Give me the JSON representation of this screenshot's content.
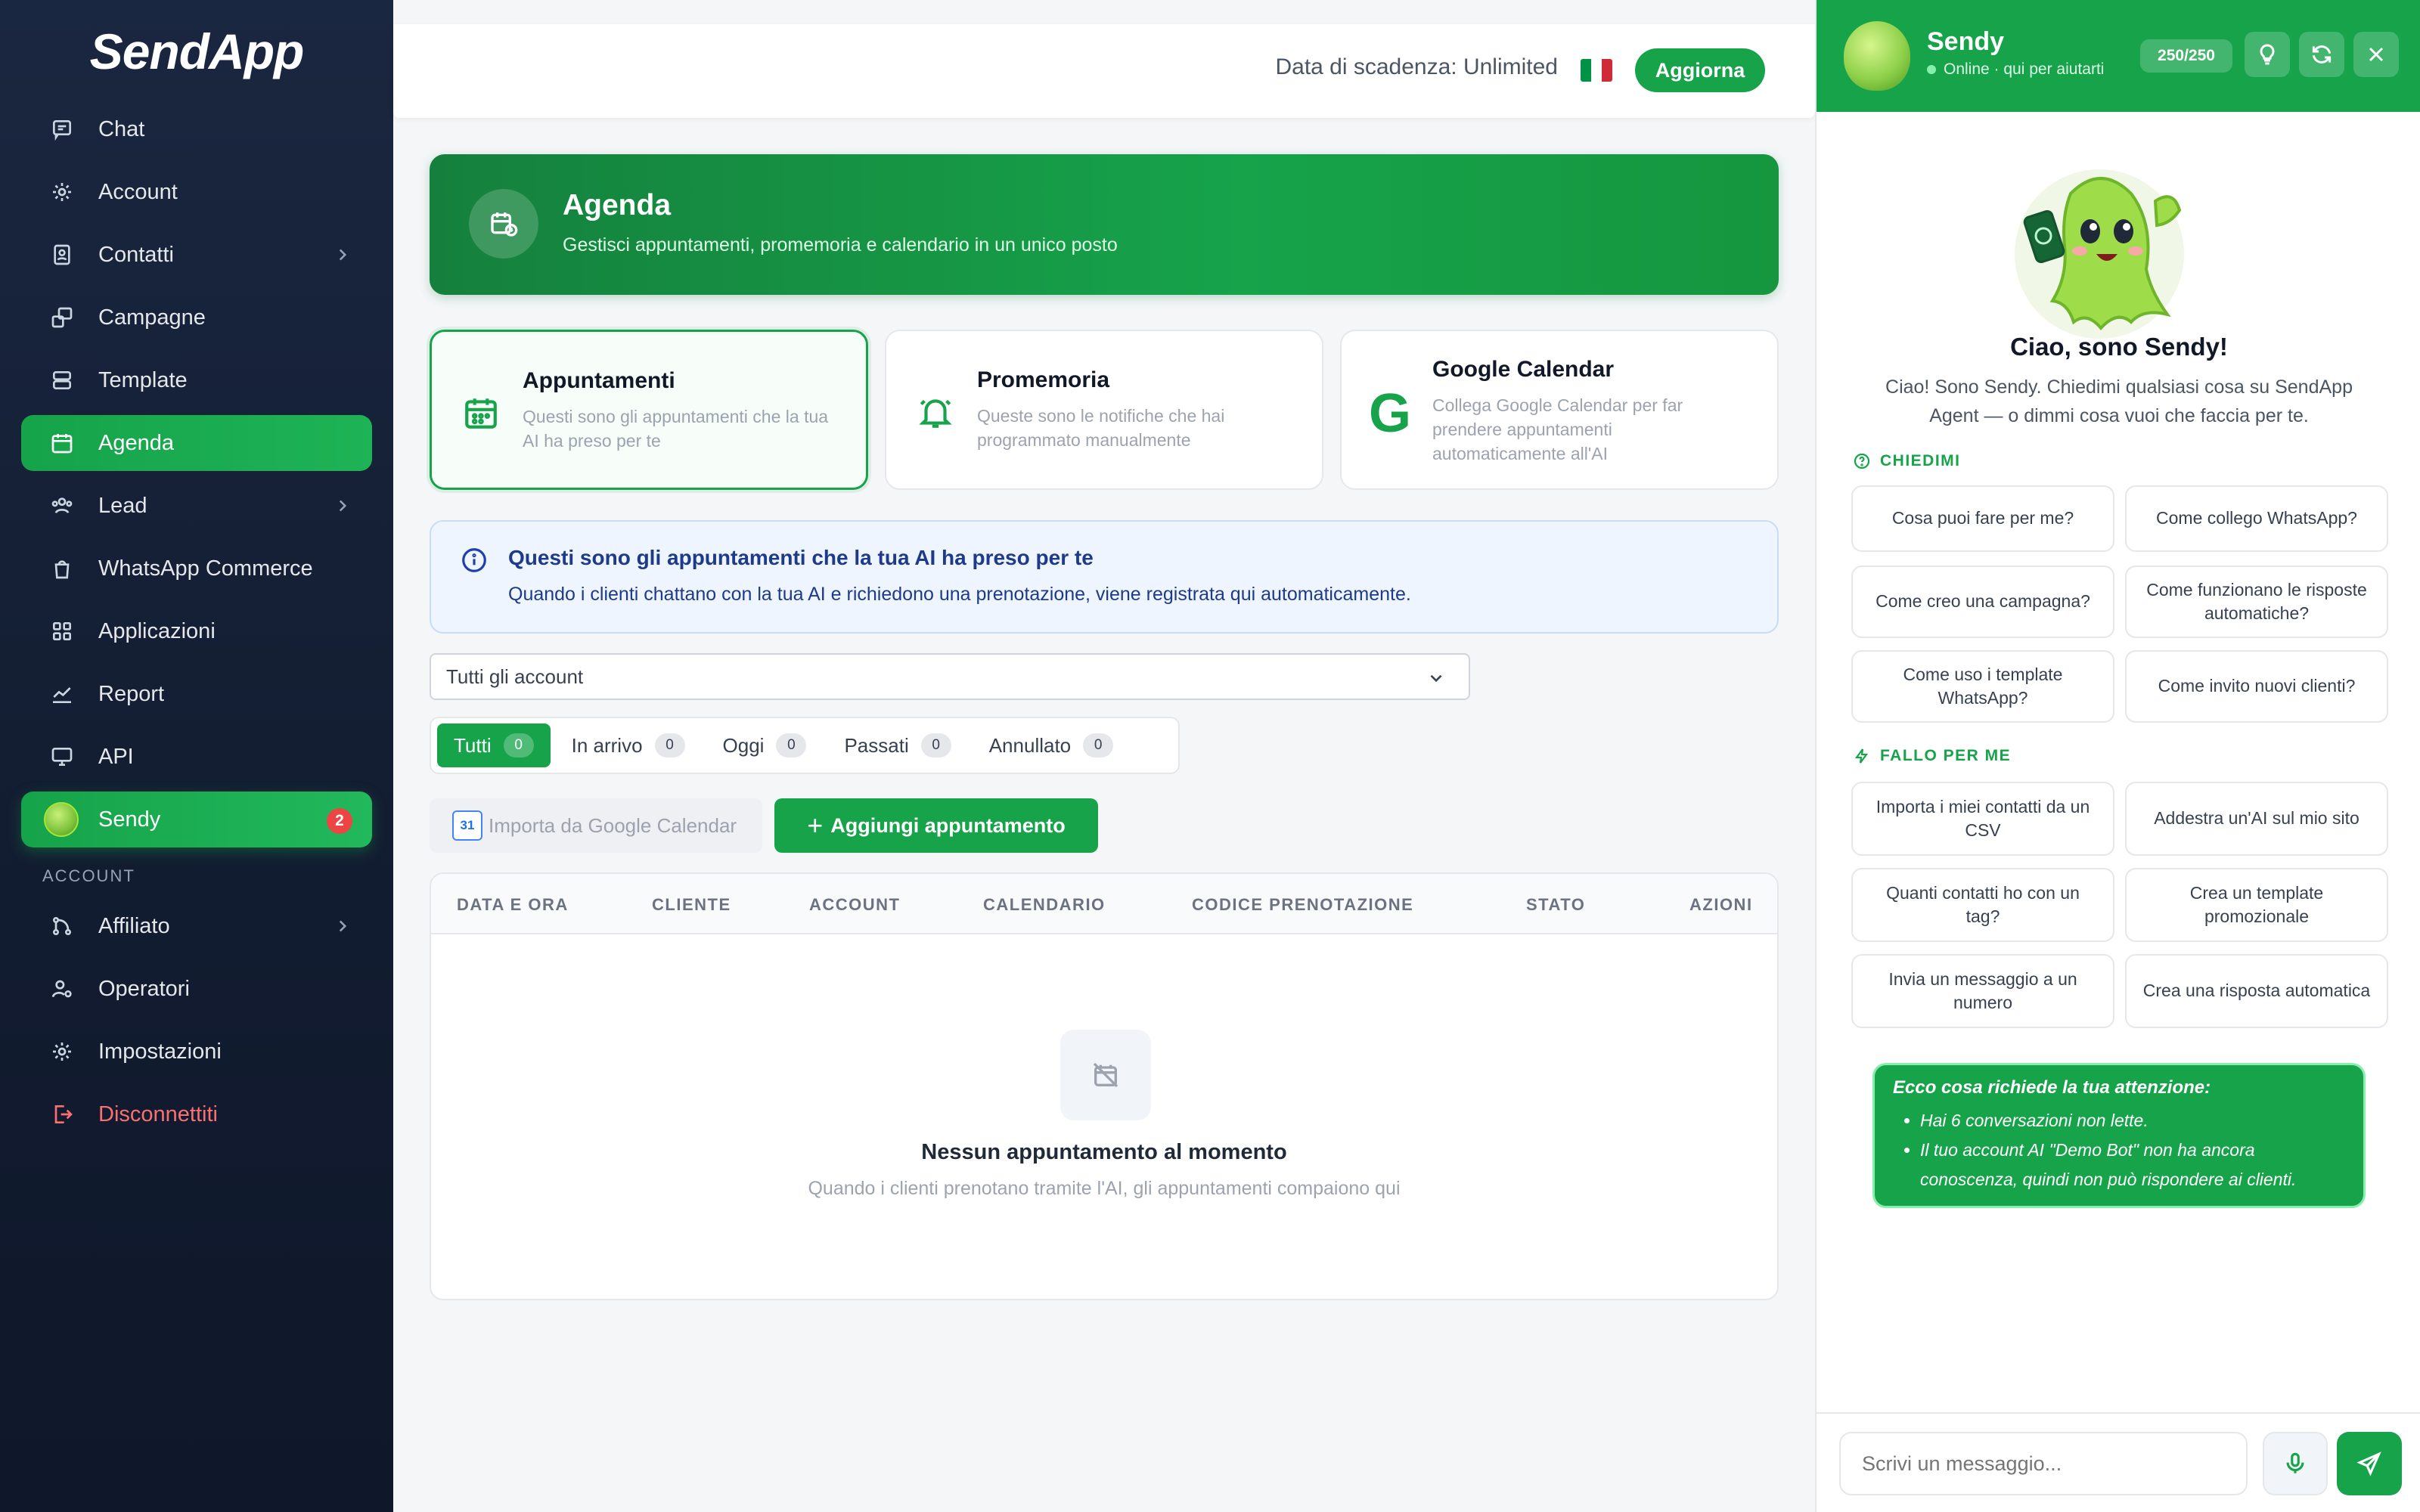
{
  "app": {
    "logo": "SendApp"
  },
  "sidebar": {
    "items": [
      {
        "label": "Chat",
        "icon": "chat-icon"
      },
      {
        "label": "Account",
        "icon": "gear-icon"
      },
      {
        "label": "Contatti",
        "icon": "contacts-icon"
      },
      {
        "label": "Campagne",
        "icon": "campaign-icon"
      },
      {
        "label": "Template",
        "icon": "template-icon"
      },
      {
        "label": "Agenda",
        "icon": "calendar-icon",
        "active": true
      },
      {
        "label": "Lead",
        "icon": "lead-icon"
      },
      {
        "label": "WhatsApp Commerce",
        "icon": "bag-icon"
      },
      {
        "label": "Applicazioni",
        "icon": "apps-icon"
      },
      {
        "label": "Report",
        "icon": "chart-icon"
      },
      {
        "label": "API",
        "icon": "monitor-icon"
      }
    ],
    "sendy": {
      "label": "Sendy",
      "badge": "2"
    },
    "section_label": "ACCOUNT",
    "account_items": [
      {
        "label": "Affiliato",
        "icon": "affiliate-icon"
      },
      {
        "label": "Operatori",
        "icon": "operator-icon"
      },
      {
        "label": "Impostazioni",
        "icon": "gear-icon"
      },
      {
        "label": "Disconnettiti",
        "icon": "logout-icon"
      }
    ]
  },
  "topbar": {
    "expiry": "Data di scadenza: Unlimited",
    "upgrade_label": "Aggiorna",
    "flag_colors": [
      "#009246",
      "#ffffff",
      "#ce2b37"
    ]
  },
  "hero": {
    "title": "Agenda",
    "subtitle": "Gestisci appuntamenti, promemoria e calendario in un unico posto"
  },
  "cards": [
    {
      "title": "Appuntamenti",
      "desc": "Questi sono gli appuntamenti che la tua AI ha preso per te"
    },
    {
      "title": "Promemoria",
      "desc": "Queste sono le notifiche che hai programmato manualmente"
    },
    {
      "title": "Google Calendar",
      "desc": "Collega Google Calendar per far prendere appuntamenti automaticamente all'AI",
      "glyph": "G"
    }
  ],
  "info": {
    "title": "Questi sono gli appuntamenti che la tua AI ha preso per te",
    "text": "Quando i clienti chattano con la tua AI e richiedono una prenotazione, viene registrata qui automaticamente."
  },
  "filter": {
    "selected": "Tutti gli account"
  },
  "tabs": [
    {
      "label": "Tutti",
      "count": "0"
    },
    {
      "label": "In arrivo",
      "count": "0"
    },
    {
      "label": "Oggi",
      "count": "0"
    },
    {
      "label": "Passati",
      "count": "0"
    },
    {
      "label": "Annullato",
      "count": "0"
    }
  ],
  "actions": {
    "import_label": "Importa da Google Calendar",
    "import_icon_text": "31",
    "add_label": "Aggiungi appuntamento",
    "add_symbol": "+"
  },
  "table": {
    "columns": [
      "DATA E ORA",
      "CLIENTE",
      "ACCOUNT",
      "CALENDARIO",
      "CODICE PRENOTAZIONE",
      "STATO",
      "AZIONI"
    ],
    "empty_title": "Nessun appuntamento al momento",
    "empty_sub": "Quando i clienti prenotano tramite l'AI, gli appuntamenti compaiono qui"
  },
  "assistant": {
    "name": "Sendy",
    "status": "Online · qui per aiutarti",
    "quota": "250/250",
    "greeting_title": "Ciao, sono Sendy!",
    "greeting_text": "Ciao! Sono Sendy. Chiedimi qualsiasi cosa su SendApp Agent — o dimmi cosa vuoi che faccia per te.",
    "ask_label": "CHIEDIMI",
    "ask_chips": [
      "Cosa puoi fare per me?",
      "Come collego WhatsApp?",
      "Come creo una campagna?",
      "Come funzionano le risposte automatiche?",
      "Come uso i template WhatsApp?",
      "Come invito nuovi clienti?"
    ],
    "do_label": "FALLO PER ME",
    "do_chips": [
      "Importa i miei contatti da un CSV",
      "Addestra un'AI sul mio sito",
      "Quanti contatti ho con un tag?",
      "Crea un template promozionale",
      "Invia un messaggio a un numero",
      "Crea una risposta automatica"
    ],
    "alert_title": "Ecco cosa richiede la tua attenzione:",
    "alert_items": [
      "Hai 6 conversazioni non lette.",
      "Il tuo account AI \"Demo Bot\" non ha ancora conoscenza, quindi non può rispondere ai clienti."
    ],
    "input_placeholder": "Scrivi un messaggio..."
  }
}
